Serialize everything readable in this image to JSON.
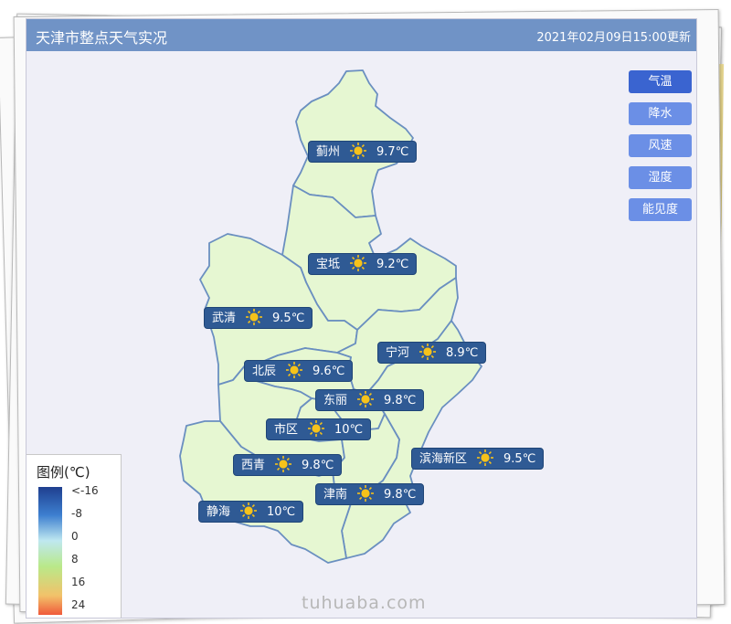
{
  "header": {
    "title": "天津市整点天气实况",
    "updated": "2021年02月09日15:00更新"
  },
  "side_buttons": [
    {
      "label": "气温",
      "active": true
    },
    {
      "label": "降水",
      "active": false
    },
    {
      "label": "风速",
      "active": false
    },
    {
      "label": "湿度",
      "active": false
    },
    {
      "label": "能见度",
      "active": false
    }
  ],
  "stations": [
    {
      "name": "蓟州",
      "weather_icon": "sun-icon",
      "temp": "9.7℃"
    },
    {
      "name": "宝坻",
      "weather_icon": "sun-icon",
      "temp": "9.2℃"
    },
    {
      "name": "武清",
      "weather_icon": "sun-icon",
      "temp": "9.5℃"
    },
    {
      "name": "宁河",
      "weather_icon": "sun-icon",
      "temp": "8.9℃"
    },
    {
      "name": "北辰",
      "weather_icon": "sun-icon",
      "temp": "9.6℃"
    },
    {
      "name": "东丽",
      "weather_icon": "sun-icon",
      "temp": "9.8℃"
    },
    {
      "name": "市区",
      "weather_icon": "sun-icon",
      "temp": "10℃"
    },
    {
      "name": "西青",
      "weather_icon": "sun-icon",
      "temp": "9.8℃"
    },
    {
      "name": "滨海新区",
      "weather_icon": "sun-icon",
      "temp": "9.5℃"
    },
    {
      "name": "津南",
      "weather_icon": "sun-icon",
      "temp": "9.8℃"
    },
    {
      "name": "静海",
      "weather_icon": "sun-icon",
      "temp": "10℃"
    }
  ],
  "legend": {
    "title": "图例(℃)",
    "ticks": [
      "<-16",
      "-8",
      "0",
      "8",
      "16",
      "24"
    ]
  },
  "colors": {
    "header_bg": "#7093c6",
    "map_fill": "#e6f7d2",
    "map_stroke": "#6a8fc0",
    "label_bg": "#2f5a94",
    "button_bg": "#6b8fe6",
    "button_active_bg": "#3a64d0",
    "sun": "#f6c21a"
  },
  "watermark": "tuhuaba.com"
}
